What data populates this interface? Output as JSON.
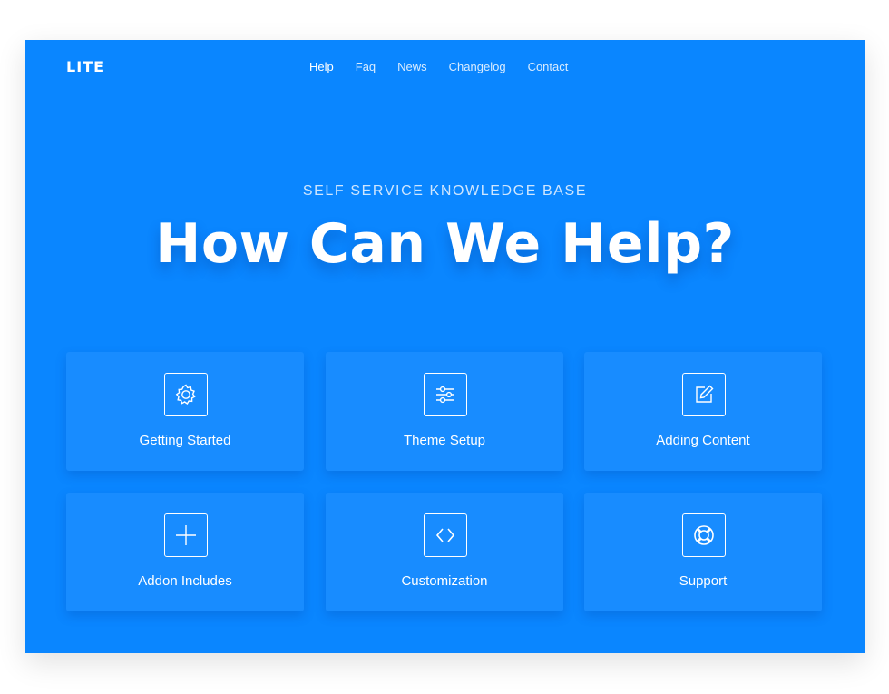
{
  "brand": {
    "logo": "LITE"
  },
  "nav": {
    "items": [
      {
        "label": "Help",
        "active": true
      },
      {
        "label": "Faq",
        "active": false
      },
      {
        "label": "News",
        "active": false
      },
      {
        "label": "Changelog",
        "active": false
      },
      {
        "label": "Contact",
        "active": false
      }
    ]
  },
  "hero": {
    "eyebrow": "SELF SERVICE KNOWLEDGE BASE",
    "title": "How Can We Help?"
  },
  "cards": [
    {
      "label": "Getting Started",
      "icon": "gear-icon"
    },
    {
      "label": "Theme Setup",
      "icon": "sliders-icon"
    },
    {
      "label": "Adding Content",
      "icon": "edit-icon"
    },
    {
      "label": "Addon Includes",
      "icon": "plus-icon"
    },
    {
      "label": "Customization",
      "icon": "code-icon"
    },
    {
      "label": "Support",
      "icon": "lifebuoy-icon"
    }
  ],
  "colors": {
    "background": "#0a86ff",
    "card": "#188cff",
    "text": "#ffffff"
  }
}
